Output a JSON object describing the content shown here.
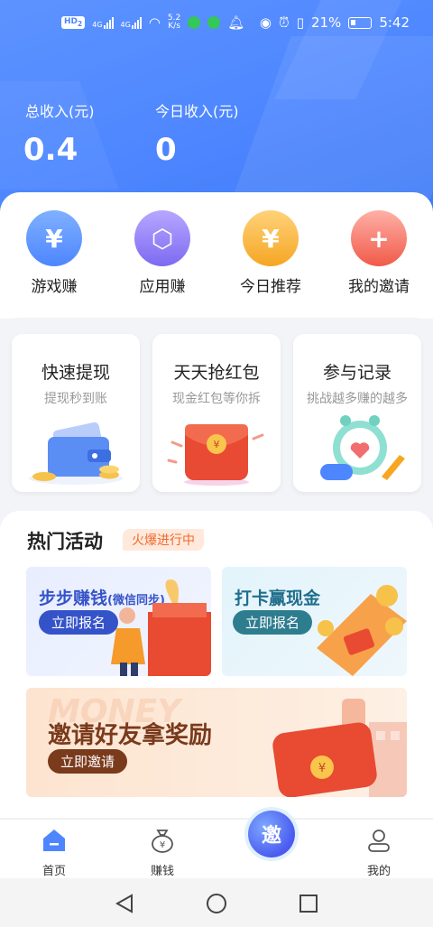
{
  "status_bar": {
    "hd": "HD",
    "hd_sub": "2",
    "net1": "4G",
    "net2": "4G",
    "speed_top": "5.2",
    "speed_bottom": "K/s",
    "battery": "21%",
    "time": "5:42"
  },
  "income": {
    "total_label": "总收入(元)",
    "total_value": "0.4",
    "today_label": "今日收入(元)",
    "today_value": "0"
  },
  "quick_menu": [
    {
      "label": "游戏赚",
      "icon": "yen-shield-icon",
      "glyph": "¥"
    },
    {
      "label": "应用赚",
      "icon": "apps-cube-icon",
      "glyph": "⬡"
    },
    {
      "label": "今日推荐",
      "icon": "yen-coin-icon",
      "glyph": "¥"
    },
    {
      "label": "我的邀请",
      "icon": "red-envelope-icon",
      "glyph": "+"
    }
  ],
  "features": [
    {
      "title": "快速提现",
      "subtitle": "提现秒到账",
      "icon": "wallet-icon"
    },
    {
      "title": "天天抢红包",
      "subtitle": "现金红包等你拆",
      "icon": "red-envelope-icon"
    },
    {
      "title": "参与记录",
      "subtitle": "挑战越多赚的越多",
      "icon": "alarm-clock-icon"
    }
  ],
  "hot": {
    "title": "热门活动",
    "tag": "火爆进行中",
    "banners": [
      {
        "title": "步步赚钱",
        "title_note": "(微信同步)",
        "button": "立即报名"
      },
      {
        "title": "打卡赢现金",
        "button": "立即报名"
      },
      {
        "title": "邀请好友拿奖励",
        "watermark": "MONEY",
        "button": "立即邀请"
      }
    ]
  },
  "nav": {
    "items": [
      {
        "label": "首页",
        "icon": "home-icon",
        "active": true
      },
      {
        "label": "赚钱",
        "icon": "money-bag-icon",
        "active": false
      },
      {
        "label": "我的",
        "icon": "user-icon",
        "active": false
      }
    ],
    "invite_glyph": "邀"
  },
  "colors": {
    "primary": "#4d86ff",
    "accent_orange": "#f06a2b",
    "banner_red": "#e84a32"
  }
}
